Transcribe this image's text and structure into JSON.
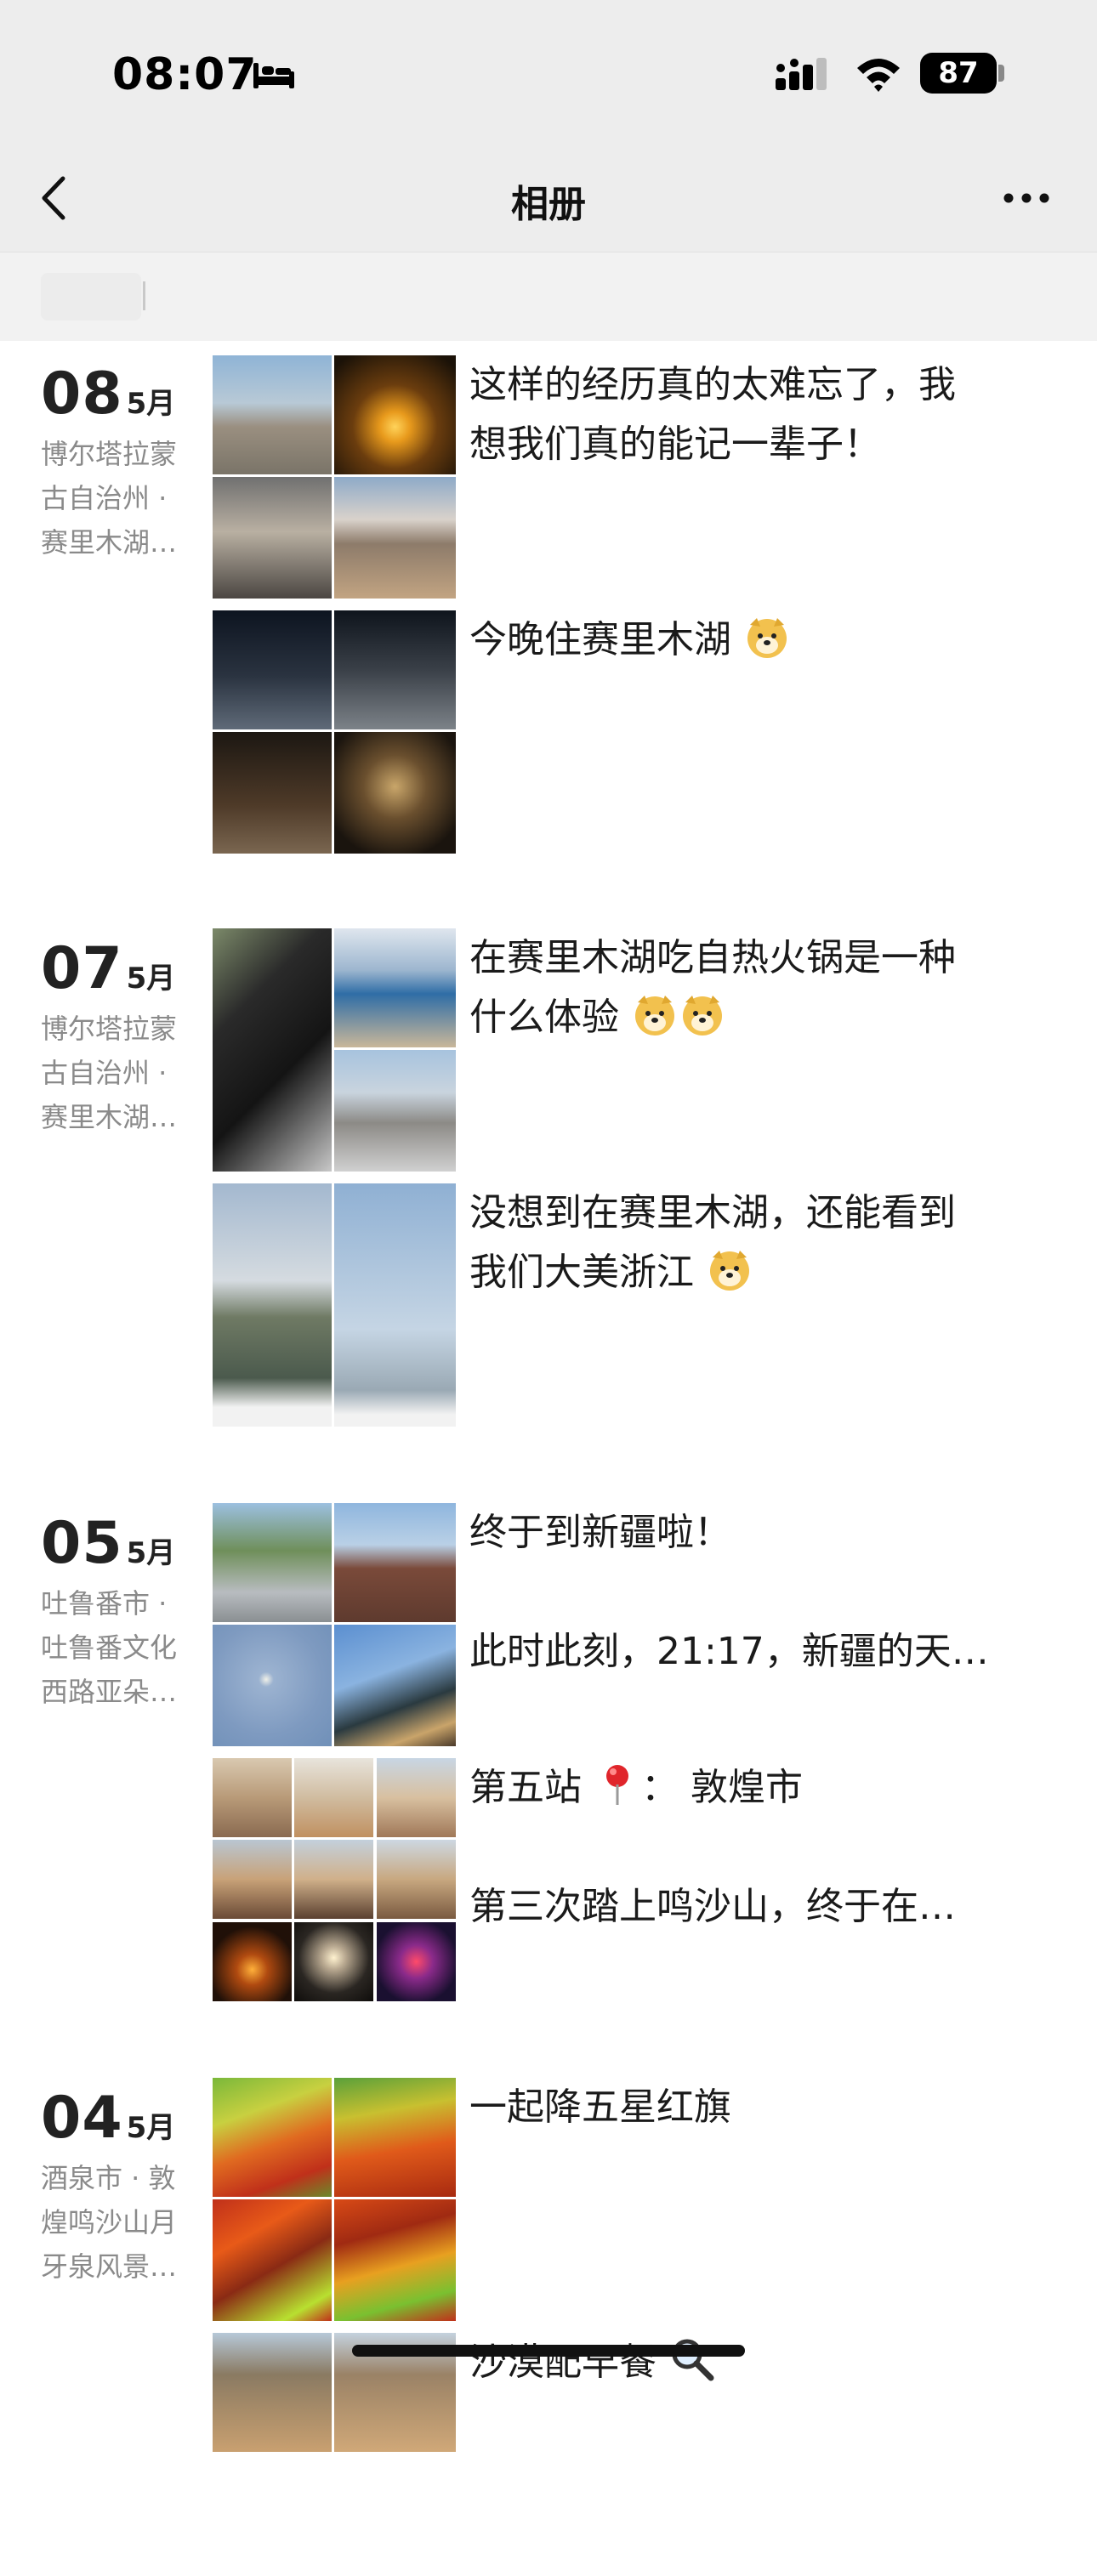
{
  "status_bar": {
    "time": "08:07",
    "battery": "87"
  },
  "nav": {
    "title": "相册"
  },
  "sections": [
    {
      "day": "08",
      "month": "5月",
      "location": [
        "博尔塔拉蒙",
        "古自治州 ·",
        "赛里木湖…"
      ],
      "posts": [
        {
          "lines": [
            "这样的经历真的太难忘了，我",
            "想我们真的能记一辈子！"
          ]
        },
        {
          "lines": [
            "今晚住赛里木湖"
          ]
        }
      ]
    },
    {
      "day": "07",
      "month": "5月",
      "location": [
        "博尔塔拉蒙",
        "古自治州 ·",
        "赛里木湖…"
      ],
      "posts": [
        {
          "lines": [
            "在赛里木湖吃自热火锅是一种",
            "什么体验"
          ]
        },
        {
          "lines": [
            "没想到在赛里木湖，还能看到",
            "我们大美浙江"
          ]
        }
      ]
    },
    {
      "day": "05",
      "month": "5月",
      "location": [
        "吐鲁番市 ·",
        "吐鲁番文化",
        "西路亚朵…"
      ],
      "posts": [
        {
          "lines": [
            "终于到新疆啦！",
            "",
            "此时此刻，21:17，新疆的天…"
          ]
        },
        {
          "lines": [
            "第五站",
            "",
            "第三次踏上鸣沙山，终于在…"
          ],
          "pin_text": "： 敦煌市"
        }
      ]
    },
    {
      "day": "04",
      "month": "5月",
      "location": [
        "酒泉市 · 敦",
        "煌鸣沙山月",
        "牙泉风景…"
      ],
      "posts": [
        {
          "lines": [
            "一起降五星红旗"
          ]
        },
        {
          "lines": [
            "沙漠配早餐"
          ]
        }
      ]
    }
  ]
}
